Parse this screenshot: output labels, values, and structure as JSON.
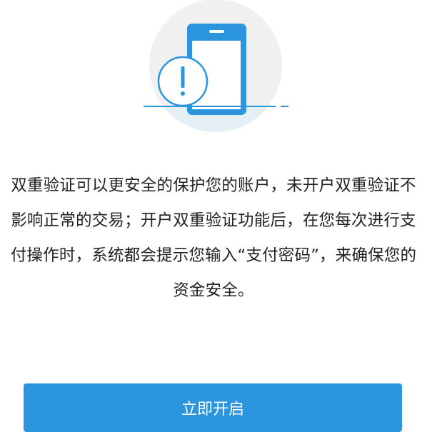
{
  "description": {
    "lines": [
      "双重验证可以更安全的保护您的账户，未开户双重验证不",
      "影响正常的交易；开户双重验证功能后，在您每次进行支",
      "付操作时，系统都会提示您输入“支付密码”，来确保您的",
      "资金安全。"
    ]
  },
  "action": {
    "button_label": "立即开启"
  },
  "colors": {
    "accent": "#2b95dd",
    "circle_bg": "#f0f0f0",
    "circle_bottom": "#e3eef5",
    "text": "#222222"
  },
  "icons": [
    "phone-icon",
    "exclamation-icon"
  ]
}
